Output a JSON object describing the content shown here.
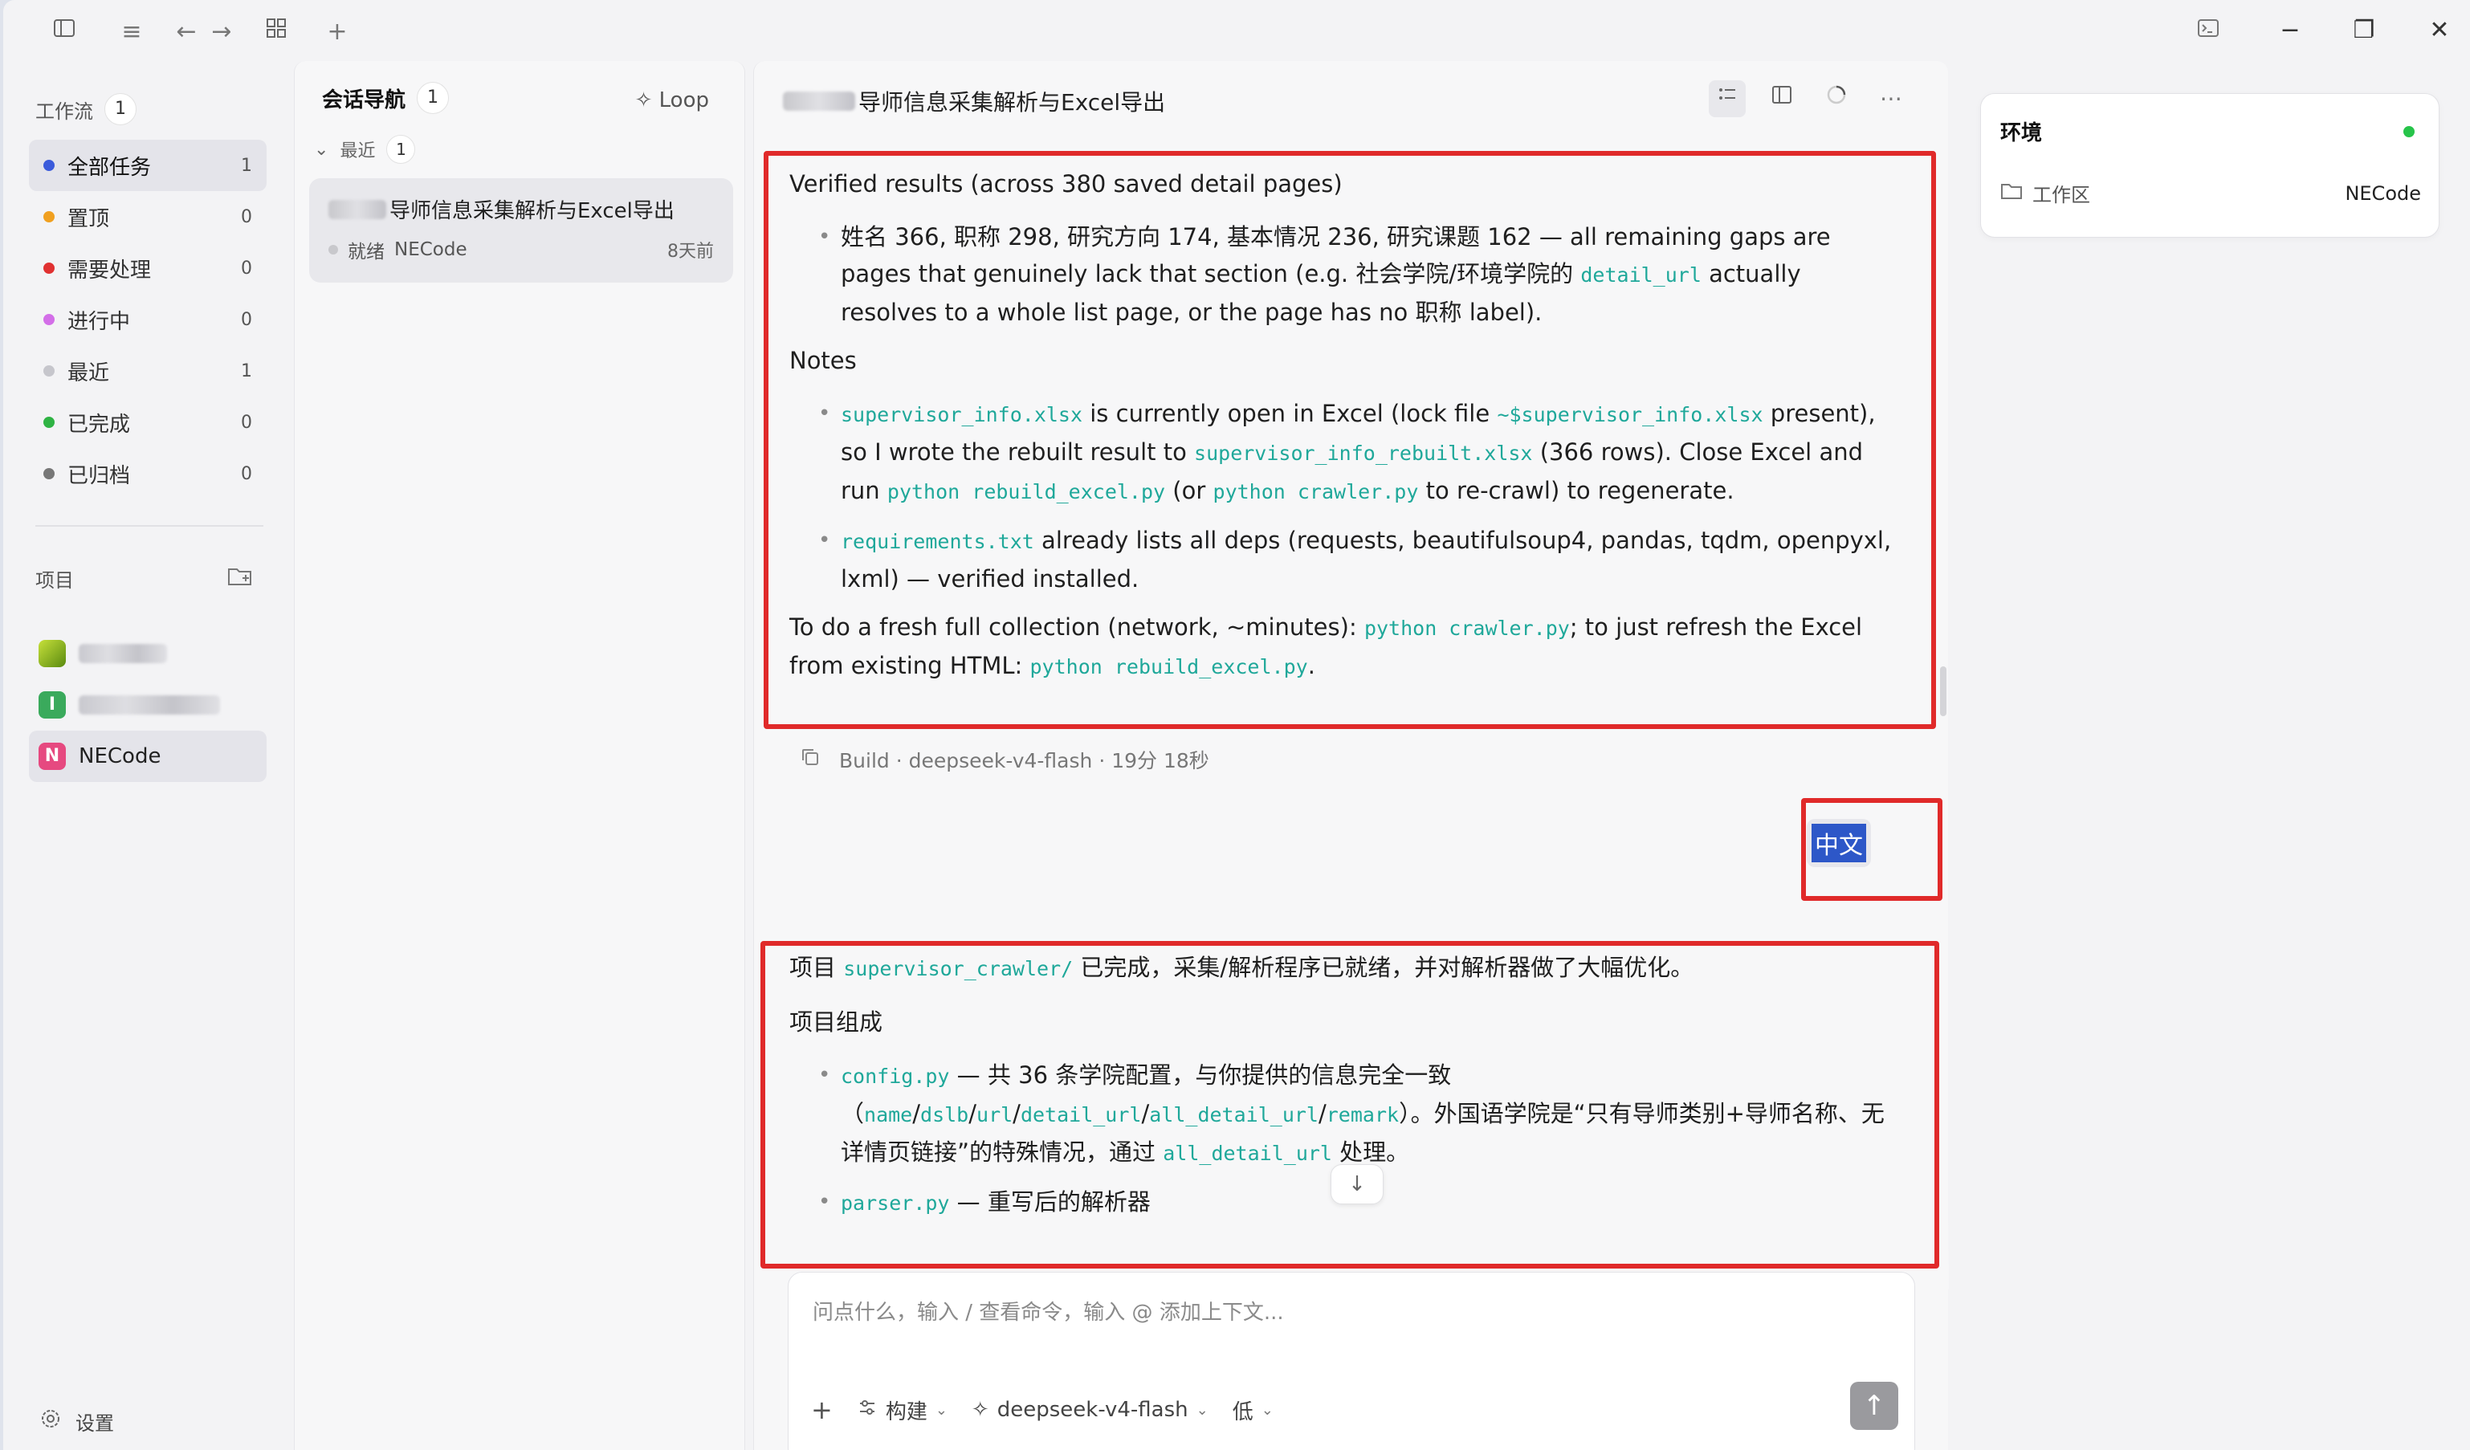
{
  "titlebar": {
    "icons": [
      "sidebar-toggle-icon",
      "menu-icon",
      "back-arrow-icon",
      "forward-arrow-icon",
      "grid-icon",
      "plus-icon",
      "terminal-icon",
      "minimize-icon",
      "restore-icon",
      "close-icon"
    ]
  },
  "sidebar": {
    "workflow_label": "工作流",
    "workflow_count": "1",
    "items": [
      {
        "label": "全部任务",
        "count": "1",
        "color": "#3b5bdb"
      },
      {
        "label": "置顶",
        "count": "0",
        "color": "#f0a020"
      },
      {
        "label": "需要处理",
        "count": "0",
        "color": "#e03131"
      },
      {
        "label": "进行中",
        "count": "0",
        "color": "#d36ee8"
      },
      {
        "label": "最近",
        "count": "1",
        "color": "#c6c6cc"
      },
      {
        "label": "已完成",
        "count": "0",
        "color": "#2fb344"
      },
      {
        "label": "已归档",
        "count": "0",
        "color": "#777777"
      }
    ],
    "projects_label": "项目",
    "projects": [
      {
        "badge": "",
        "badge_color": "#7cb518",
        "name": ""
      },
      {
        "badge": "I",
        "badge_color": "#3aaa5c",
        "name": ""
      },
      {
        "badge": "N",
        "badge_color": "#e64980",
        "name": "NECode"
      }
    ],
    "settings_label": "设置"
  },
  "conv_panel": {
    "title": "会话导航",
    "count": "1",
    "loop_label": "Loop",
    "group_label": "最近",
    "group_count": "1",
    "conversation": {
      "title": "导师信息采集解析与Excel导出",
      "status": "就绪",
      "project": "NECode",
      "ago": "8天前"
    }
  },
  "chat": {
    "title": "导师信息采集解析与Excel导出",
    "msg1": {
      "heading": "Verified results (across 380 saved detail pages)",
      "bullet1": {
        "t1": "姓名 366, 职称 298, 研究方向 174, 基本情况 236, 研究课题 162 — all remaining gaps are pages that genuinely lack that section (e.g. 社会学院/环境学院的 ",
        "c1": "detail_url",
        "t2": " actually resolves to a whole list page, or the page has no 职称 label)."
      },
      "notes_label": "Notes",
      "bullet2": {
        "c1": "supervisor_info.xlsx",
        "t1": " is currently open in Excel (lock file ",
        "c2": "~$supervisor_info.xlsx",
        "t2": " present), so I wrote the rebuilt result to ",
        "c3": "supervisor_info_rebuilt.xlsx",
        "t3": " (366 rows). Close Excel and run ",
        "c4": "python rebuild_excel.py",
        "t4": " (or ",
        "c5": "python crawler.py",
        "t5": " to re-crawl) to regenerate."
      },
      "bullet3": {
        "c1": "requirements.txt",
        "t1": " already lists all deps (requests, beautifulsoup4, pandas, tqdm, openpyxl, lxml) — verified installed."
      },
      "footer": {
        "t1": "To do a fresh full collection (network, ~minutes): ",
        "c1": "python crawler.py",
        "t2": "; to just refresh the Excel from existing HTML: ",
        "c2": "python rebuild_excel.py",
        "t3": "."
      }
    },
    "meta": "Build · deepseek-v4-flash · 19分 18秒",
    "user_message": "中文",
    "msg2": {
      "p1": {
        "t1": "项目 ",
        "c1": "supervisor_crawler/",
        "t2": " 已完成，采集/解析程序已就绪，并对解析器做了大幅优化。"
      },
      "section": "项目组成",
      "b1": {
        "c1": "config.py",
        "t1": " — 共 36 条学院配置，与你提供的信息完全一致（",
        "c2": "name",
        "c3": "dslb",
        "c4": "url",
        "c5": "detail_url",
        "c6": "all_detail_url",
        "c7": "remark",
        "t2": "）。外国语学院是“只有导师类别+导师名称、无详情页链接”的特殊情况，通过 ",
        "c8": "all_detail_url",
        "t3": " 处理。"
      },
      "b2": {
        "c1": "parser.py",
        "t1": " — 重写后的解析器"
      }
    }
  },
  "composer": {
    "placeholder": "问点什么，输入 / 查看命令，输入 @ 添加上下文...",
    "mode": "构建",
    "model": "deepseek-v4-flash",
    "level": "低"
  },
  "env": {
    "title": "环境",
    "row_label": "工作区",
    "row_value": "NECode",
    "status_color": "#27c44a"
  }
}
